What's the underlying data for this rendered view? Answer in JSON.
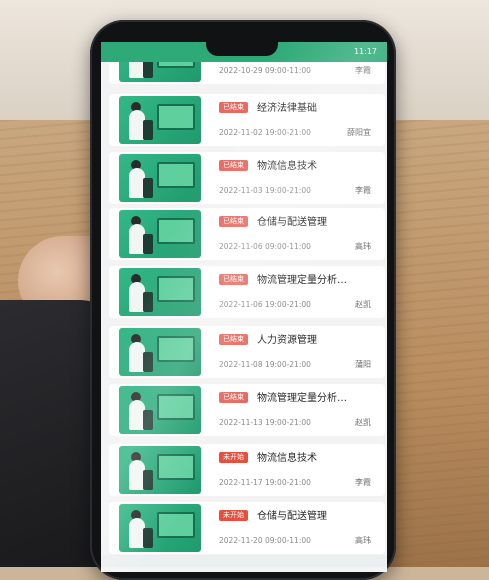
{
  "status_bar": {
    "left_text": "",
    "right_text": "11:17"
  },
  "courses": [
    {
      "badge": "",
      "title": "",
      "time": "2022-10-29 09:00-11:00",
      "teacher": "李霞"
    },
    {
      "badge": "已结束",
      "title": "经济法律基础",
      "time": "2022-11-02 19:00-21:00",
      "teacher": "薛阳宜"
    },
    {
      "badge": "已结束",
      "title": "物流信息技术",
      "time": "2022-11-03 19:00-21:00",
      "teacher": "李霞"
    },
    {
      "badge": "已结束",
      "title": "仓储与配送管理",
      "time": "2022-11-06 09:00-11:00",
      "teacher": "高玮"
    },
    {
      "badge": "已结束",
      "title": "物流管理定量分析…",
      "time": "2022-11-06 19:00-21:00",
      "teacher": "赵凯"
    },
    {
      "badge": "已结束",
      "title": "人力资源管理",
      "time": "2022-11-08 19:00-21:00",
      "teacher": "蒲阳"
    },
    {
      "badge": "已结束",
      "title": "物流管理定量分析…",
      "time": "2022-11-13 19:00-21:00",
      "teacher": "赵凯"
    },
    {
      "badge": "未开始",
      "title": "物流信息技术",
      "time": "2022-11-17 19:00-21:00",
      "teacher": "李霞"
    },
    {
      "badge": "未开始",
      "title": "仓储与配送管理",
      "time": "2022-11-20 09:00-11:00",
      "teacher": "高玮"
    }
  ],
  "colors": {
    "status_bar": "#2eaa78",
    "badge_ended": "#e46a62",
    "badge_pending": "#e44f3e",
    "thumb_green": "#2eb384"
  },
  "icons": {
    "thumbnail": "scientist-microscope-illustration"
  }
}
